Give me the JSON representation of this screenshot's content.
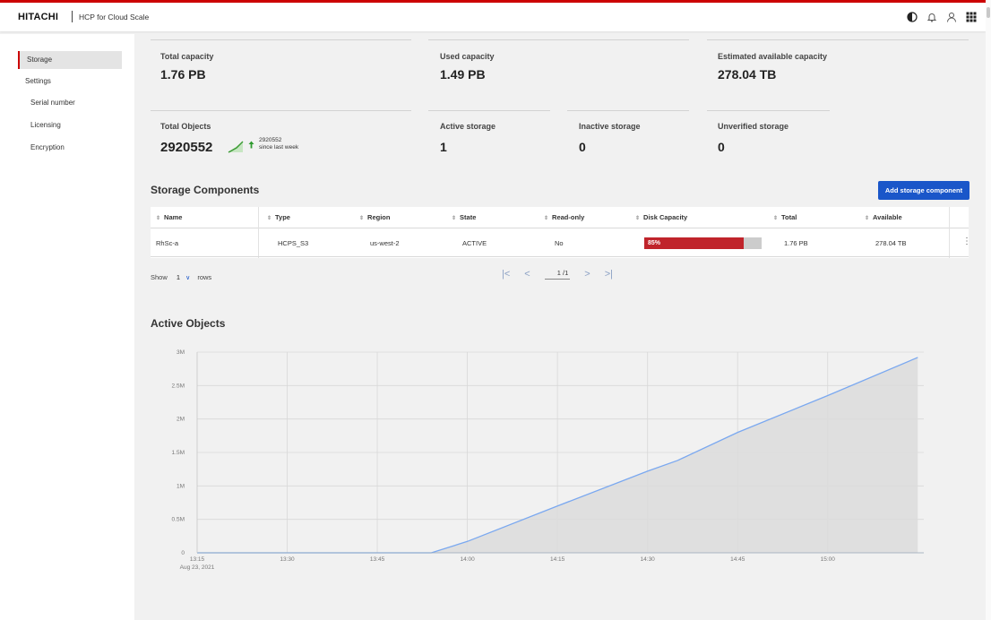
{
  "header": {
    "brand": "HITACHI",
    "product": "HCP for Cloud Scale",
    "icons": [
      "contrast-icon",
      "bell-icon",
      "user-icon",
      "apps-grid-icon"
    ]
  },
  "sidebar": {
    "items": [
      {
        "label": "Storage",
        "active": true
      },
      {
        "label": "Settings"
      },
      {
        "label": "Serial number",
        "sub": true
      },
      {
        "label": "Licensing",
        "sub": true
      },
      {
        "label": "Encryption",
        "sub": true
      }
    ]
  },
  "kpis": {
    "total_capacity": {
      "label": "Total capacity",
      "value": "1.76 PB"
    },
    "used_capacity": {
      "label": "Used capacity",
      "value": "1.49 PB"
    },
    "estimated_available": {
      "label": "Estimated available capacity",
      "value": "278.04 TB"
    },
    "total_objects": {
      "label": "Total Objects",
      "value": "2920552",
      "trend_value": "2920552",
      "trend_text": "since last week"
    },
    "active_storage": {
      "label": "Active storage",
      "value": "1"
    },
    "inactive_storage": {
      "label": "Inactive storage",
      "value": "0"
    },
    "unverified_storage": {
      "label": "Unverified storage",
      "value": "0"
    }
  },
  "storage_components": {
    "title": "Storage Components",
    "add_button": "Add storage component",
    "columns": [
      "Name",
      "Type",
      "Region",
      "State",
      "Read-only",
      "Disk Capacity",
      "Total",
      "Available"
    ],
    "rows": [
      {
        "name": "RhSc-a",
        "type": "HCPS_S3",
        "region": "us-west-2",
        "state": "ACTIVE",
        "read_only": "No",
        "disk_capacity": "85%",
        "disk_capacity_fraction": 0.85,
        "total": "1.76 PB",
        "available": "278.04 TB"
      }
    ],
    "pagination": {
      "show_label": "Show",
      "rows_value": "1",
      "rows_label": "rows",
      "page": "1",
      "total_pages": "/1"
    }
  },
  "active_objects": {
    "title": "Active Objects"
  },
  "colors": {
    "accent_red": "#cc0000",
    "button_blue": "#1a56c9",
    "bar_red": "#c0242b",
    "line_blue": "#7aa8f0"
  },
  "chart_data": {
    "type": "area",
    "title": "Active Objects",
    "x": [
      "13:15",
      "13:30",
      "13:45",
      "13:55",
      "14:00",
      "14:15",
      "14:30",
      "14:35",
      "14:45",
      "15:00",
      "15:15"
    ],
    "x_minutes": [
      0,
      15,
      30,
      39,
      45,
      60,
      75,
      80,
      90,
      105,
      120
    ],
    "series": [
      {
        "values": [
          0,
          0,
          0,
          0,
          170000,
          700000,
          1220000,
          1380000,
          1800000,
          2350000,
          2920552
        ]
      }
    ],
    "x_tick_labels": [
      "13:15",
      "13:30",
      "13:45",
      "14:00",
      "14:15",
      "14:30",
      "14:45",
      "15:00"
    ],
    "x_date_label": "Aug 23, 2021",
    "y_tick_labels": [
      "0",
      "0.5M",
      "1M",
      "1.5M",
      "2M",
      "2.5M",
      "3M"
    ],
    "ylim": [
      0,
      3000000
    ],
    "xlim_minutes": [
      0,
      121
    ],
    "grid": true
  }
}
